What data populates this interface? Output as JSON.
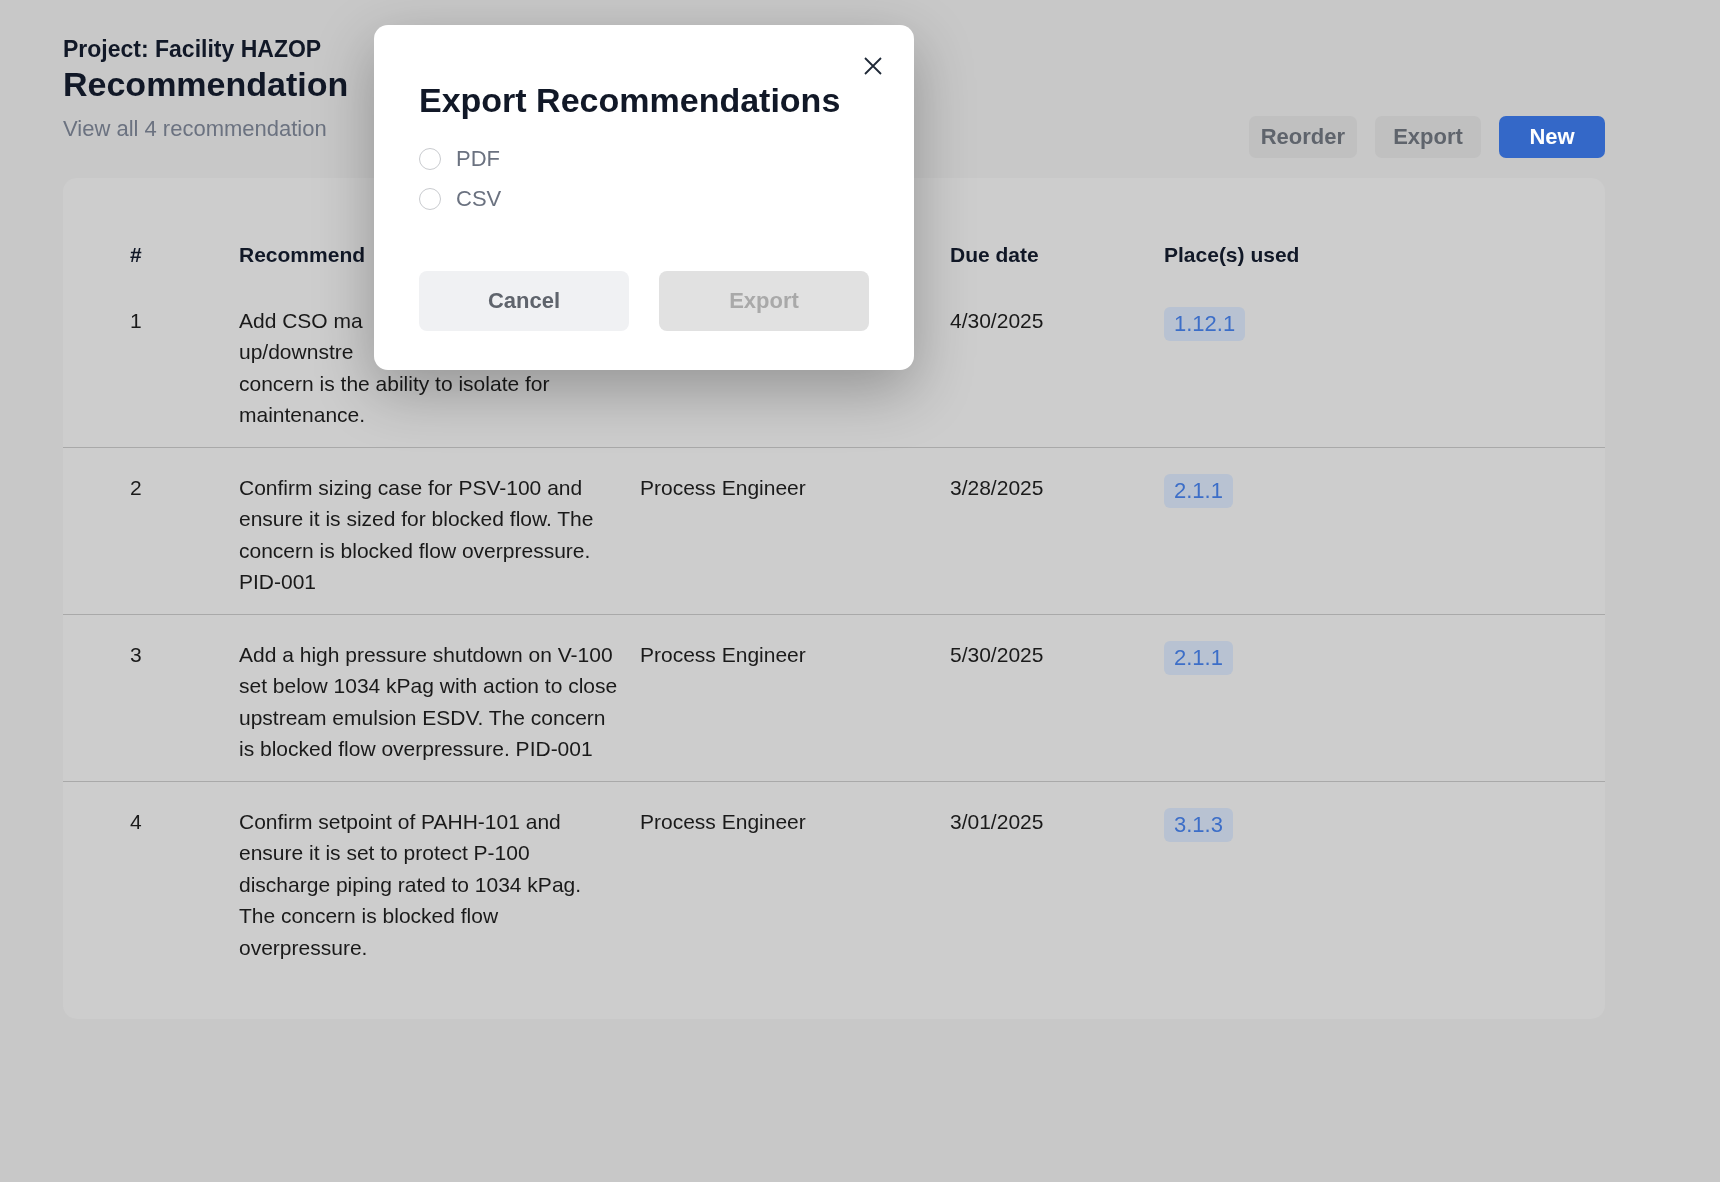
{
  "project": "Project: Facility HAZOP",
  "title": "Recommendation",
  "subtitle": "View all 4 recommendation",
  "actions": [
    {
      "label": "Reorder",
      "kind": "secondary"
    },
    {
      "label": "Export",
      "kind": "secondary"
    },
    {
      "label": "New",
      "kind": "primary"
    }
  ],
  "table": {
    "columns": [
      {
        "label": "#"
      },
      {
        "label": "Recommend"
      },
      {
        "label": "Due date"
      },
      {
        "label": "Place(s) used"
      }
    ],
    "rows": [
      {
        "number": "1",
        "recommendation_lines": [
          "Add CSO ma",
          "up/downstre",
          "concern is the ability to isolate for",
          "maintenance."
        ],
        "due_date": "4/30/2025",
        "places": [
          "1.12.1"
        ]
      },
      {
        "number": "2",
        "recommendation": "Confirm sizing case for PSV-100 and ensure it is sized for blocked flow. The concern is blocked flow overpressure. PID-001",
        "responsible": "Process Engineer",
        "due_date": "3/28/2025",
        "places": [
          "2.1.1"
        ]
      },
      {
        "number": "3",
        "recommendation": "Add a high pressure shutdown on V-100 set below 1034 kPag with action to close upstream emulsion ESDV. The concern is blocked flow overpressure. PID-001",
        "responsible": "Process Engineer",
        "due_date": "5/30/2025",
        "places": [
          "2.1.1"
        ]
      },
      {
        "number": "4",
        "recommendation": "Confirm setpoint of PAHH-101 and ensure it is set to protect P-100 discharge piping rated to 1034 kPag. The concern is blocked flow overpressure.",
        "responsible": "Process Engineer",
        "due_date": "3/01/2025",
        "places": [
          "3.1.3"
        ]
      }
    ]
  },
  "dialog": {
    "title": "Export Recommendations",
    "options": [
      {
        "label": "PDF",
        "selected": false
      },
      {
        "label": "CSV",
        "selected": false
      }
    ],
    "buttons": [
      {
        "label": "Cancel",
        "disabled": false
      },
      {
        "label": "Export",
        "disabled": true
      }
    ]
  }
}
